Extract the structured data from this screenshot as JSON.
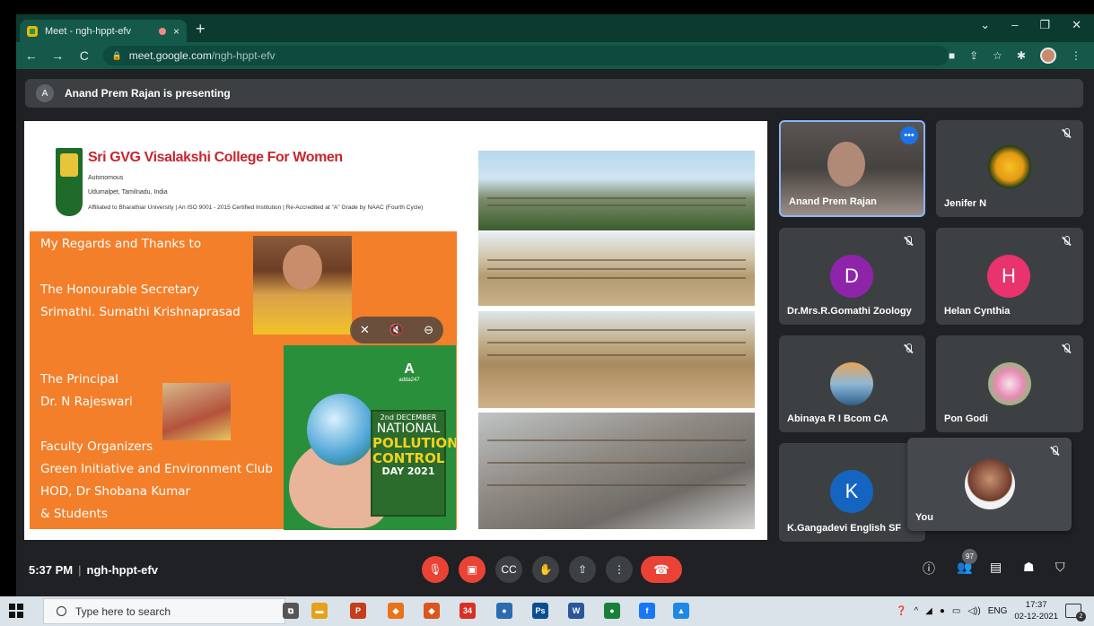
{
  "browser": {
    "tab_title": "Meet - ngh-hppt-efv",
    "tab_close": "×",
    "new_tab": "+",
    "window_controls": [
      "⌄",
      "–",
      "❐",
      "✕"
    ],
    "url_domain": "meet.google.com",
    "url_path": "/ngh-hppt-efv",
    "nav": {
      "back": "←",
      "forward": "→",
      "reload": "C"
    }
  },
  "meet": {
    "presenting_initial": "A",
    "presenting_text": "Anand Prem Rajan is presenting",
    "time": "5:37 PM",
    "separator": "|",
    "meeting_code": "ngh-hppt-efv",
    "participant_count": "97"
  },
  "slide": {
    "college_name": "Sri GVG Visalakshi College For Women",
    "autonomous": "Autonomous",
    "location": "Udumalpet, Tamilnadu, India",
    "affiliation": "Affiliated to Bharathiar University | An ISO 9001 - 2015 Certified Institution | Re-Accredited at \"A\" Grade by NAAC (Fourth Cycle)",
    "lines": [
      "My Regards and Thanks to",
      "The Honourable Secretary",
      "Srimathi. Sumathi Krishnaprasad",
      "The Principal",
      "Dr. N Rajeswari",
      "Faculty Organizers",
      "Green Initiative and Environment Club",
      "HOD, Dr Shobana Kumar",
      "& Students"
    ],
    "poster": {
      "brand_letter": "A",
      "brand_name": "adda247",
      "date": "2nd DECEMBER",
      "line1": "NATIONAL",
      "line2": "POLLUTION",
      "line3": "CONTROL",
      "line4": "DAY 2021"
    }
  },
  "participants": [
    {
      "name": "Anand Prem Rajan",
      "more": "•••"
    },
    {
      "name": "Jenifer N"
    },
    {
      "name": "Dr.Mrs.R.Gomathi Zoology",
      "initial": "D",
      "color": "#8e24aa"
    },
    {
      "name": "Helan Cynthia",
      "initial": "H",
      "color": "#e8336e"
    },
    {
      "name": "Abinaya R I Bcom CA"
    },
    {
      "name": "Pon Godi"
    },
    {
      "name": "K.Gangadevi English SF",
      "initial": "K",
      "color": "#1565c0"
    },
    {
      "name": "You"
    }
  ],
  "taskbar": {
    "search_placeholder": "Type here to search",
    "lang": "ENG",
    "time": "17:37",
    "date": "02-12-2021",
    "notif_count": "2",
    "apps": [
      {
        "name": "task-view",
        "label": "⧉",
        "color": "#555"
      },
      {
        "name": "file-explorer",
        "label": "▬",
        "color": "#e3a21a"
      },
      {
        "name": "powerpoint",
        "label": "P",
        "color": "#c43e1c"
      },
      {
        "name": "app-orange-1",
        "label": "◆",
        "color": "#e8731a"
      },
      {
        "name": "app-orange-2",
        "label": "◆",
        "color": "#d9561e"
      },
      {
        "name": "chrome-badge",
        "label": "34",
        "color": "#d93025"
      },
      {
        "name": "app-blue",
        "label": "●",
        "color": "#2b6cb0"
      },
      {
        "name": "photoshop",
        "label": "Ps",
        "color": "#0b4f91"
      },
      {
        "name": "word",
        "label": "W",
        "color": "#2b579a"
      },
      {
        "name": "chrome",
        "label": "●",
        "color": "#188038"
      },
      {
        "name": "facebook",
        "label": "f",
        "color": "#1877f2"
      },
      {
        "name": "photos",
        "label": "▲",
        "color": "#1e88e5"
      }
    ]
  }
}
